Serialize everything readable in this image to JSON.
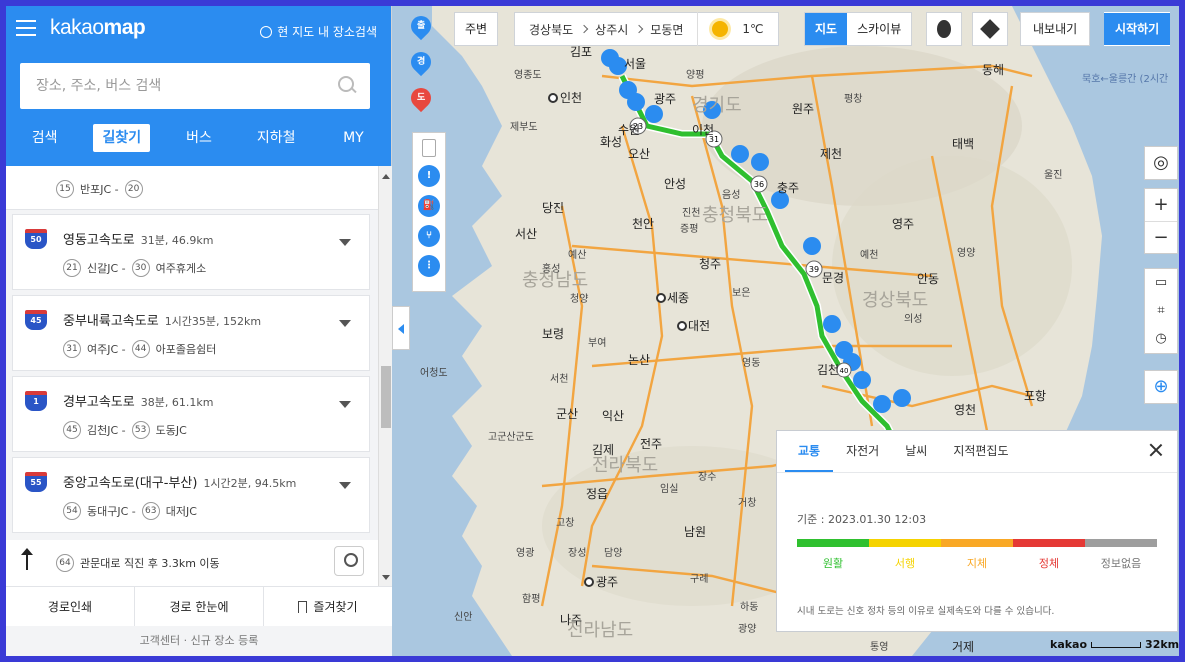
{
  "app": {
    "logo_light": "kakao",
    "logo_bold": "map",
    "here_search": "현 지도 내 장소검색"
  },
  "search": {
    "placeholder": "장소, 주소, 버스 검색"
  },
  "tabs": [
    "검색",
    "길찾기",
    "버스",
    "지하철",
    "MY"
  ],
  "route_top": {
    "stop1_num": "15",
    "stop1_name": "반포JC -",
    "stop2_num": "20"
  },
  "roads": [
    {
      "shield": "50",
      "name": "영동고속도로",
      "meta": "31분, 46.9km",
      "s1n": "21",
      "s1": "신갈JC -",
      "s2n": "30",
      "s2": "여주휴게소"
    },
    {
      "shield": "45",
      "name": "중부내륙고속도로",
      "meta": "1시간35분, 152km",
      "s1n": "31",
      "s1": "여주JC -",
      "s2n": "44",
      "s2": "아포졸음쉼터"
    },
    {
      "shield": "1",
      "name": "경부고속도로",
      "meta": "38분, 61.1km",
      "s1n": "45",
      "s1": "김천JC -",
      "s2n": "53",
      "s2": "도동JC"
    },
    {
      "shield": "55",
      "name": "중앙고속도로(대구-부산)",
      "meta": "1시간2분, 94.5km",
      "s1n": "54",
      "s1": "동대구JC -",
      "s2n": "63",
      "s2": "대저JC"
    }
  ],
  "final_step": {
    "num": "64",
    "text": "관문대로 직진 후 3.3km 이동"
  },
  "footer": {
    "print": "경로인쇄",
    "overview": "경로 한눈에",
    "bookmark": "즐겨찾기"
  },
  "bottom_links": "고객센터 · 신규 장소 등록",
  "topbar": {
    "nearby": "주변",
    "crumbs": [
      "경상북도",
      "상주시",
      "모동면"
    ],
    "temp": "1℃",
    "map_mode": "지도",
    "skyview": "스카이뷰",
    "export": "내보내기",
    "start": "시작하기"
  },
  "left_pins": [
    "출",
    "경",
    "도"
  ],
  "traffic": {
    "tabs": [
      "교통",
      "자전거",
      "날씨",
      "지적편집도"
    ],
    "time": "기준 : 2023.01.30 12:03",
    "levels": [
      {
        "label": "원활",
        "color": "#2fc02f"
      },
      {
        "label": "서행",
        "color": "#f5d300"
      },
      {
        "label": "지체",
        "color": "#f9a825"
      },
      {
        "label": "정체",
        "color": "#e53935"
      },
      {
        "label": "정보없음",
        "color": "#9e9e9e"
      }
    ],
    "note": "시내 도로는 신호 정차 등의 이유로 실제속도와 다를 수 있습니다."
  },
  "map_labels": {
    "gimpo": "김포",
    "seoul": "서울",
    "incheon": "인천",
    "yeongjongdo": "영종도",
    "yangpyeong": "양평",
    "gwangju_g": "광주",
    "wonju": "원주",
    "pyeongchang": "평창",
    "donghae": "동해",
    "hwaseong": "화성",
    "jebudo": "제부도",
    "osan": "오산",
    "suwon": "수원",
    "icheon": "이천",
    "jecheon": "제천",
    "taebaek": "태백",
    "anseong": "안성",
    "chungju": "충주",
    "eumseong": "음성",
    "dangjin": "당진",
    "cheonan": "천안",
    "jincheon": "진천",
    "jeungpyeong": "증평",
    "yeongju": "영주",
    "uljin": "울진",
    "seosan": "서산",
    "cheongju": "청주",
    "yesan": "예산",
    "hongseong": "홍성",
    "mungyeong": "문경",
    "yecheon": "예천",
    "yeongyang": "영양",
    "andong": "안동",
    "sejong": "세종",
    "boeun": "보은",
    "cheongyang": "청양",
    "boryeong": "보령",
    "daejeon": "대전",
    "uiseong": "의성",
    "buyeo": "부여",
    "nonsan": "논산",
    "yeongdong": "영동",
    "eocheongdo": "어청도",
    "seocheon": "서천",
    "gimcheon": "김천",
    "pohang": "포항",
    "gunsan": "군산",
    "iksan": "익산",
    "yeongcheon": "영천",
    "gogunsan": "고군산군도",
    "gimje": "김제",
    "jeonju": "전주",
    "jangsu": "장수",
    "jeongeup": "정읍",
    "imsil": "임실",
    "geochang": "거창",
    "gochang": "고창",
    "namwon": "남원",
    "yeonggwang": "영광",
    "jangseong": "장성",
    "damyang": "담양",
    "gurye": "구례",
    "gwangju": "광주",
    "hadong": "하동",
    "sinan": "신안",
    "hampyeong": "함평",
    "naju": "나주",
    "gwangyang": "광양",
    "tongyeong": "통영",
    "geoje": "거제",
    "chungnam": "충청남도",
    "chungbuk": "충청북도",
    "gyeongbuk": "경상북도",
    "jeonbuk": "전라북도",
    "jeonnam": "전라남도",
    "gyeonggi": "경기도",
    "sea_route": "묵호←울릉간 (2시간",
    "sea_route2": "(2시간"
  },
  "map_codes": {
    "c31": "31",
    "c36": "36",
    "c39": "39",
    "c23": "23",
    "c40": "40"
  },
  "scale": {
    "brand": "kakao",
    "distance": "32km"
  }
}
